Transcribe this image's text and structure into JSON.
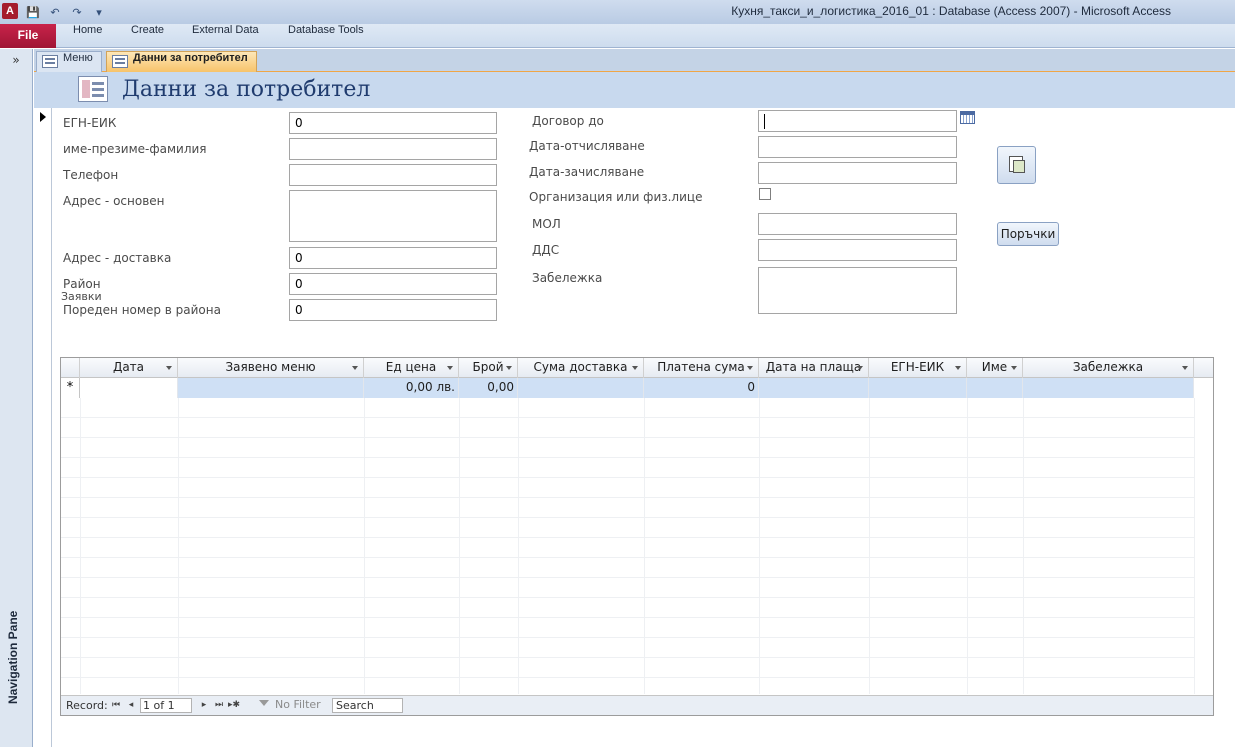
{
  "window": {
    "app_badge": "A",
    "title": "Кухня_такси_и_логистика_2016_01 : Database (Access 2007)  -  Microsoft Access"
  },
  "ribbon": {
    "file": "File",
    "tabs": [
      "Home",
      "Create",
      "External Data",
      "Database Tools"
    ]
  },
  "nav_pane": {
    "label": "Navigation Pane",
    "toggle": "»"
  },
  "doc_tabs": {
    "menu": "Меню",
    "active": "Данни за потребител"
  },
  "form": {
    "title": "Данни за потребител",
    "left_fields": [
      {
        "label": "ЕГН-ЕИК",
        "value": "0"
      },
      {
        "label": "име-презиме-фамилия",
        "value": ""
      },
      {
        "label": "Телефон",
        "value": ""
      },
      {
        "label": "Адрес - основен",
        "value": ""
      },
      {
        "label": "Адрес - доставка",
        "value": "0"
      },
      {
        "label": "Район",
        "value": "0"
      },
      {
        "label": "Пореден номер в района",
        "value": "0"
      }
    ],
    "zayavki_label": "Заявки",
    "right_fields": [
      {
        "label": "Договор до",
        "value": ""
      },
      {
        "label": "Дата-отчисляване",
        "value": ""
      },
      {
        "label": "Дата-зачисляване",
        "value": ""
      },
      {
        "label": "Организация или физ.лице",
        "value": ""
      },
      {
        "label": "МОЛ",
        "value": ""
      },
      {
        "label": "ДДС",
        "value": ""
      },
      {
        "label": "Забележка",
        "value": ""
      }
    ],
    "orders_button": "Поръчки"
  },
  "subform": {
    "columns": [
      "Дата",
      "Заявено меню",
      "Ед цена",
      "Брой",
      "Сума доставка",
      "Платена сума",
      "Дата на плаща",
      "ЕГН-ЕИК",
      "Име",
      "Забележка"
    ],
    "new_row": {
      "marker": "*",
      "cells": [
        "",
        "",
        "0,00 лв.",
        "0,00",
        "",
        "0",
        "",
        "",
        "",
        ""
      ]
    },
    "record_nav": {
      "label": "Record:",
      "position": "1 of 1",
      "filter": "No Filter",
      "search": "Search"
    }
  }
}
